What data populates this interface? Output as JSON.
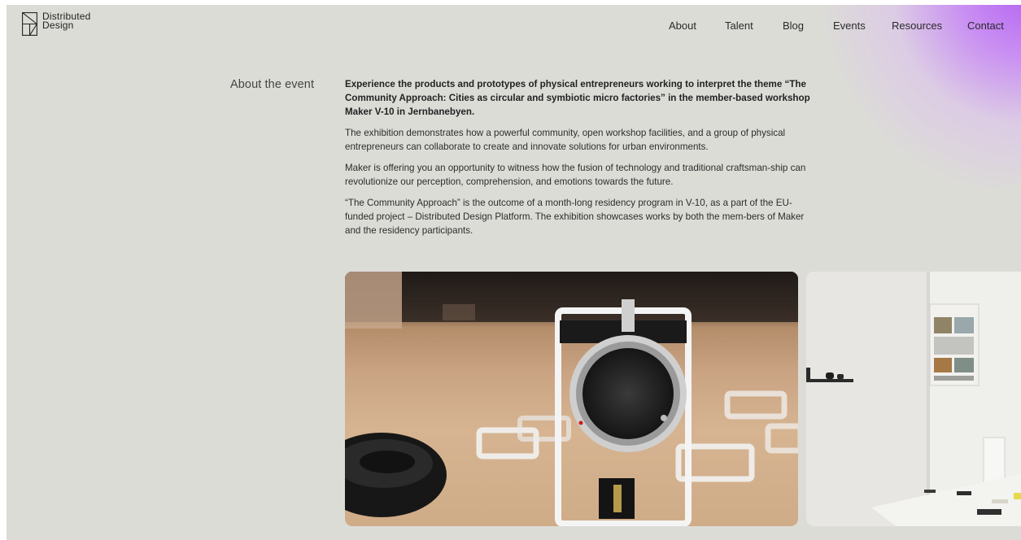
{
  "brand": {
    "line1": "Distributed",
    "line2": "Design"
  },
  "nav": {
    "items": [
      {
        "label": "About"
      },
      {
        "label": "Talent"
      },
      {
        "label": "Blog"
      },
      {
        "label": "Events"
      },
      {
        "label": "Resources"
      },
      {
        "label": "Contact"
      }
    ]
  },
  "event": {
    "section_label": "About the event",
    "lead": "Experience the products and prototypes of physical entrepreneurs working to interpret the theme “The Community Approach: Cities as circular and symbiotic micro factories” in the member-based workshop Maker V-10 in Jernbanebyen.",
    "paragraphs": [
      "The exhibition demonstrates how a powerful community, open workshop facilities, and a group of physical entrepreneurs can collaborate to create and innovate solutions for urban environments.",
      "Maker is offering you an opportunity to witness how the fusion of technology and traditional craftsman-ship can revolutionize our perception, comprehension, and emotions towards the future.",
      "“The Community Approach” is the outcome of a month-long residency program in V-10, as a part of the EU-funded project – Distributed Design Platform. The exhibition showcases works by both the mem-bers of Maker and the residency participants."
    ]
  },
  "colors": {
    "background": "#dcdcd7",
    "accent_glow": "#b565f3"
  },
  "gallery": {
    "images": [
      {
        "name": "prototype-device-photo"
      },
      {
        "name": "exhibition-wall-photo"
      }
    ]
  }
}
